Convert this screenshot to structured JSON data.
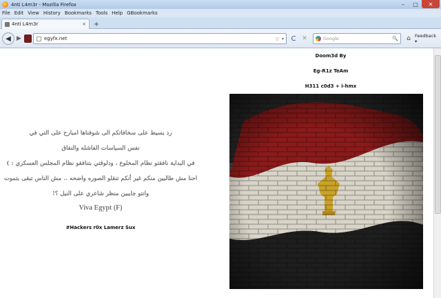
{
  "window": {
    "title": "4nti L4m3r - Mozilla Firefox",
    "controls": {
      "minimize": "–",
      "maximize": "□",
      "close": "✕"
    }
  },
  "menu": [
    "File",
    "Edit",
    "View",
    "History",
    "Bookmarks",
    "Tools",
    "Help",
    "GBookmarks"
  ],
  "tab": {
    "title": "4nti L4m3r",
    "close": "×",
    "new_tab": "+"
  },
  "nav": {
    "back": "◀",
    "forward": "▶",
    "url": "egyfx.net",
    "star": "☆",
    "dropdown": "▾",
    "reload": "C",
    "stop": "✕",
    "search_placeholder": "Google",
    "search_go": "🔍",
    "home": "⌂",
    "feedback": "Feedback ▾"
  },
  "credits": [
    "Doom3d By",
    "Eg-R1z TeAm",
    "H311 c0d3 + i-hmx"
  ],
  "message": {
    "lines": [
      "رد بسيط على سخافاتكم الى شوفناها امبارح على التي في",
      "نفس السياسات الفاشله والنفاق",
      "في البداية نافقتو نظام المخلوع ، ودلوقتي بتنافقو نظام المجلس العسكري : )",
      "احنا مش طالبين منكم غير أنكم تنقلو الصوره واضحه .. مش الناس تبقى بتموت",
      "وانتو جايبين منظر شاعري على النيل ؟!"
    ],
    "viva": "Viva Egypt (F)",
    "hackers": "#Hackers r0x Lamerz Sux"
  },
  "colors": {
    "flag_red": "#8b1a1a",
    "flag_white": "#d9d4c8",
    "flag_black": "#1e1e1e",
    "eagle_gold": "#c9a227"
  }
}
